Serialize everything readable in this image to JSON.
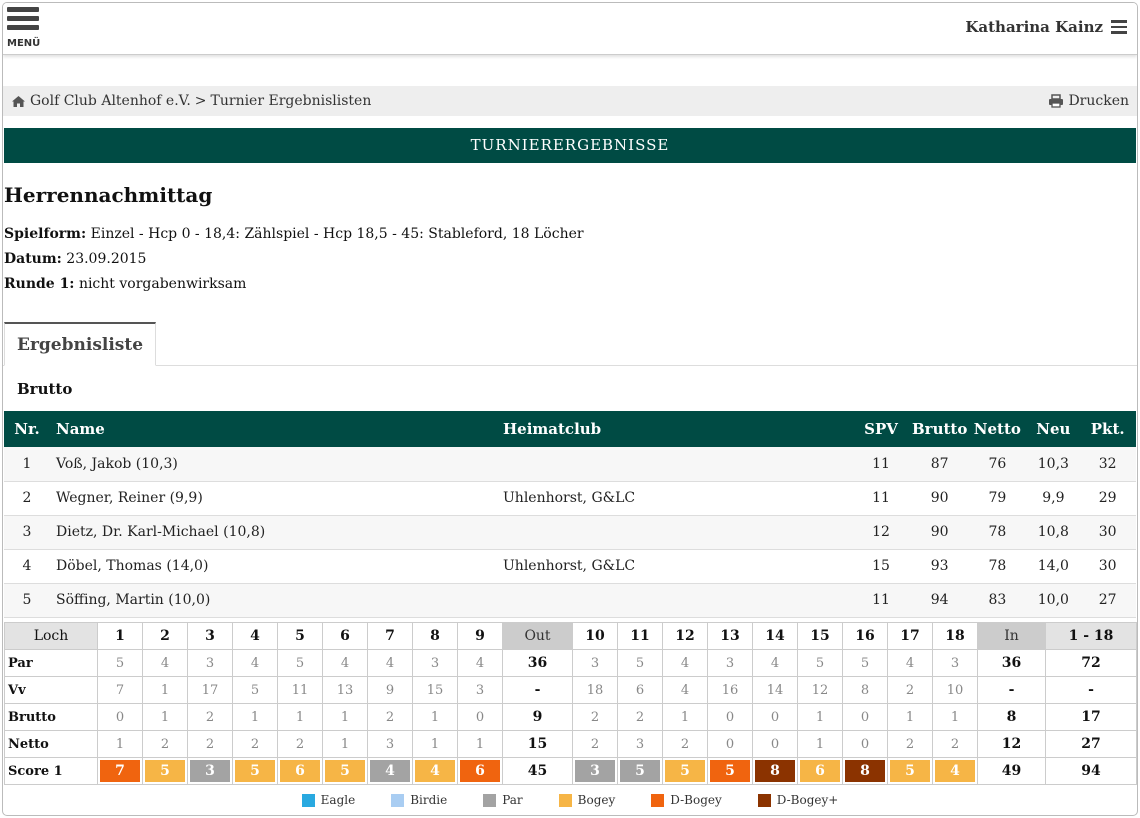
{
  "header": {
    "menu_label": "MENÜ",
    "user_name": "Katharina Kainz"
  },
  "breadcrumb": {
    "club": "Golf Club Altenhof e.V.",
    "separator": ">",
    "page": "Turnier Ergebnislisten",
    "print_label": "Drucken"
  },
  "banner": "TURNIERERGEBNISSE",
  "tournament": {
    "title": "Herrennachmittag",
    "spielform_label": "Spielform:",
    "spielform": "Einzel - Hcp 0 - 18,4: Zählspiel - Hcp 18,5 - 45: Stableford, 18 Löcher",
    "datum_label": "Datum:",
    "datum": "23.09.2015",
    "runde_label": "Runde 1:",
    "runde": "nicht vorgabenwirksam"
  },
  "tab": "Ergebnisliste",
  "section": "Brutto",
  "results": {
    "columns": [
      "Nr.",
      "Name",
      "Heimatclub",
      "SPV",
      "Brutto",
      "Netto",
      "Neu",
      "Pkt."
    ],
    "rows": [
      [
        "1",
        "Voß, Jakob (10,3)",
        "",
        "11",
        "87",
        "76",
        "10,3",
        "32"
      ],
      [
        "2",
        "Wegner, Reiner (9,9)",
        "Uhlenhorst, G&LC",
        "11",
        "90",
        "79",
        "9,9",
        "29"
      ],
      [
        "3",
        "Dietz, Dr. Karl-Michael (10,8)",
        "",
        "12",
        "90",
        "78",
        "10,8",
        "30"
      ],
      [
        "4",
        "Döbel, Thomas (14,0)",
        "Uhlenhorst, G&LC",
        "15",
        "93",
        "78",
        "14,0",
        "30"
      ],
      [
        "5",
        "Söffing, Martin (10,0)",
        "",
        "11",
        "94",
        "83",
        "10,0",
        "27"
      ]
    ]
  },
  "scorecard": {
    "header": [
      "Loch",
      "1",
      "2",
      "3",
      "4",
      "5",
      "6",
      "7",
      "8",
      "9",
      "Out",
      "10",
      "11",
      "12",
      "13",
      "14",
      "15",
      "16",
      "17",
      "18",
      "In",
      "1 - 18"
    ],
    "rows": [
      {
        "label": "Par",
        "values": [
          "5",
          "4",
          "3",
          "4",
          "5",
          "4",
          "4",
          "3",
          "4",
          "36",
          "3",
          "5",
          "4",
          "3",
          "4",
          "5",
          "5",
          "4",
          "3",
          "36",
          "72"
        ]
      },
      {
        "label": "Vv",
        "values": [
          "7",
          "1",
          "17",
          "5",
          "11",
          "13",
          "9",
          "15",
          "3",
          "-",
          "18",
          "6",
          "4",
          "16",
          "14",
          "12",
          "8",
          "2",
          "10",
          "-",
          "-"
        ]
      },
      {
        "label": "Brutto",
        "values": [
          "0",
          "1",
          "2",
          "1",
          "1",
          "1",
          "2",
          "1",
          "0",
          "9",
          "2",
          "2",
          "1",
          "0",
          "0",
          "1",
          "0",
          "1",
          "1",
          "8",
          "17"
        ]
      },
      {
        "label": "Netto",
        "values": [
          "1",
          "2",
          "2",
          "2",
          "2",
          "1",
          "3",
          "1",
          "1",
          "15",
          "2",
          "3",
          "2",
          "0",
          "0",
          "1",
          "0",
          "2",
          "2",
          "12",
          "27"
        ]
      }
    ],
    "score": {
      "label": "Score 1",
      "values": [
        "7",
        "5",
        "3",
        "5",
        "6",
        "5",
        "4",
        "4",
        "6",
        "45",
        "3",
        "5",
        "5",
        "5",
        "8",
        "6",
        "8",
        "5",
        "4",
        "49",
        "94"
      ],
      "types": [
        "dbogey",
        "bogey",
        "par",
        "bogey",
        "bogey",
        "bogey",
        "par",
        "bogey",
        "dbogey",
        "",
        "par",
        "par",
        "bogey",
        "dbogey",
        "dbogeyplus",
        "bogey",
        "dbogeyplus",
        "bogey",
        "bogey",
        "",
        ""
      ]
    }
  },
  "legend": [
    {
      "key": "eagle",
      "label": "Eagle",
      "color": "#29a9e0"
    },
    {
      "key": "birdie",
      "label": "Birdie",
      "color": "#a9cdf2"
    },
    {
      "key": "par",
      "label": "Par",
      "color": "#a3a3a3"
    },
    {
      "key": "bogey",
      "label": "Bogey",
      "color": "#f6b546"
    },
    {
      "key": "dbogey",
      "label": "D-Bogey",
      "color": "#f0640f"
    },
    {
      "key": "dbogeyplus",
      "label": "D-Bogey+",
      "color": "#8b3300"
    }
  ]
}
